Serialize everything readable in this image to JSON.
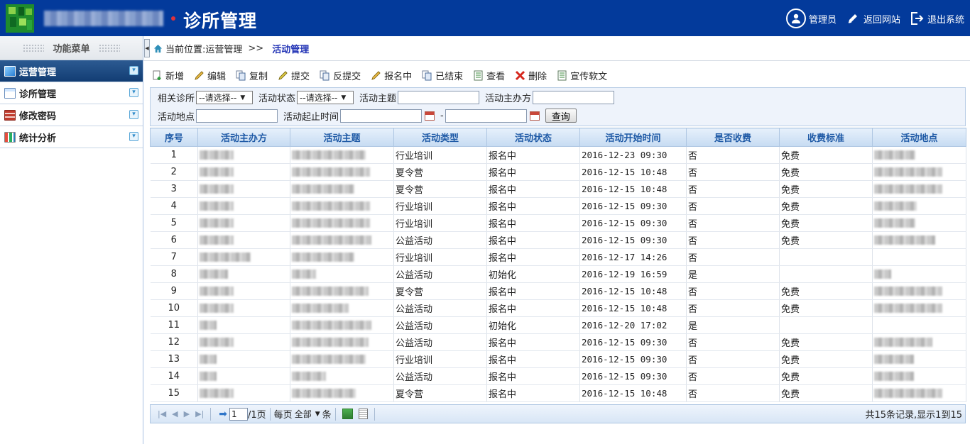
{
  "header": {
    "app_title": "诊所管理",
    "links": [
      {
        "label": "管理员",
        "icon": "user-avatar-icon"
      },
      {
        "label": "返回网站",
        "icon": "pencil-icon"
      },
      {
        "label": "退出系统",
        "icon": "logout-icon"
      }
    ]
  },
  "sidebar": {
    "title": "功能菜单",
    "items": [
      {
        "label": "运营管理",
        "active": true,
        "icon": "operations-icon"
      },
      {
        "label": "诊所管理",
        "active": false,
        "icon": "clinic-window-icon"
      },
      {
        "label": "修改密码",
        "active": false,
        "icon": "password-grid-icon"
      },
      {
        "label": "统计分析",
        "active": false,
        "icon": "bar-chart-icon"
      }
    ]
  },
  "breadcrumb": {
    "prefix": "当前位置:运营管理",
    "sep": ">>",
    "current": "活动管理"
  },
  "toolbar": [
    {
      "label": "新增",
      "icon": "add-doc-icon"
    },
    {
      "label": "编辑",
      "icon": "edit-pencil-icon"
    },
    {
      "label": "复制",
      "icon": "copy-icon"
    },
    {
      "label": "提交",
      "icon": "submit-pencil-icon"
    },
    {
      "label": "反提交",
      "icon": "unsubmit-icon"
    },
    {
      "label": "报名中",
      "icon": "signup-pencil-icon"
    },
    {
      "label": "已结束",
      "icon": "finished-icon"
    },
    {
      "label": "查看",
      "icon": "view-list-icon"
    },
    {
      "label": "删除",
      "icon": "delete-x-icon"
    },
    {
      "label": "宣传软文",
      "icon": "article-icon"
    }
  ],
  "filter": {
    "clinic_label": "相关诊所",
    "clinic_value": "--请选择--",
    "status_label": "活动状态",
    "status_value": "--请选择--",
    "topic_label": "活动主题",
    "topic_value": "",
    "organizer_label": "活动主办方",
    "organizer_value": "",
    "location_label": "活动地点",
    "location_value": "",
    "period_label": "活动起止时间",
    "period_start": "",
    "period_dash": "-",
    "period_end": "",
    "query_label": "查询"
  },
  "table": {
    "columns": [
      "序号",
      "活动主办方",
      "活动主题",
      "活动类型",
      "活动状态",
      "活动开始时间",
      "是否收费",
      "收费标准",
      "活动地点"
    ],
    "rows": [
      {
        "no": "1",
        "type": "行业培训",
        "status": "报名中",
        "start": "2016-12-23 09:30",
        "paid": "否",
        "fee": "免费"
      },
      {
        "no": "2",
        "type": "夏令营",
        "status": "报名中",
        "start": "2016-12-15 10:48",
        "paid": "否",
        "fee": "免费"
      },
      {
        "no": "3",
        "type": "夏令营",
        "status": "报名中",
        "start": "2016-12-15 10:48",
        "paid": "否",
        "fee": "免费"
      },
      {
        "no": "4",
        "type": "行业培训",
        "status": "报名中",
        "start": "2016-12-15 09:30",
        "paid": "否",
        "fee": "免费"
      },
      {
        "no": "5",
        "type": "行业培训",
        "status": "报名中",
        "start": "2016-12-15 09:30",
        "paid": "否",
        "fee": "免费"
      },
      {
        "no": "6",
        "type": "公益活动",
        "status": "报名中",
        "start": "2016-12-15 09:30",
        "paid": "否",
        "fee": "免费"
      },
      {
        "no": "7",
        "type": "行业培训",
        "status": "报名中",
        "start": "2016-12-17 14:26",
        "paid": "否",
        "fee": ""
      },
      {
        "no": "8",
        "type": "公益活动",
        "status": "初始化",
        "start": "2016-12-19 16:59",
        "paid": "是",
        "fee": ""
      },
      {
        "no": "9",
        "type": "夏令营",
        "status": "报名中",
        "start": "2016-12-15 10:48",
        "paid": "否",
        "fee": "免费"
      },
      {
        "no": "10",
        "type": "公益活动",
        "status": "报名中",
        "start": "2016-12-15 10:48",
        "paid": "否",
        "fee": "免费"
      },
      {
        "no": "11",
        "type": "公益活动",
        "status": "初始化",
        "start": "2016-12-20 17:02",
        "paid": "是",
        "fee": ""
      },
      {
        "no": "12",
        "type": "公益活动",
        "status": "报名中",
        "start": "2016-12-15 09:30",
        "paid": "否",
        "fee": "免费"
      },
      {
        "no": "13",
        "type": "行业培训",
        "status": "报名中",
        "start": "2016-12-15 09:30",
        "paid": "否",
        "fee": "免费"
      },
      {
        "no": "14",
        "type": "公益活动",
        "status": "报名中",
        "start": "2016-12-15 09:30",
        "paid": "否",
        "fee": "免费"
      },
      {
        "no": "15",
        "type": "夏令营",
        "status": "报名中",
        "start": "2016-12-15 10:48",
        "paid": "否",
        "fee": "免费"
      }
    ]
  },
  "pager": {
    "page_value": "1",
    "total_pages": "/1页",
    "per_page_label": "每页",
    "per_page_value": "全部",
    "unit": "条",
    "summary": "共15条记录,显示1到15"
  },
  "colors": {
    "header_bg": "#033a9b",
    "active_menu": "#1b4a85",
    "grid_header_text": "#1f5aa6",
    "breadcrumb_current": "#1d2fb4"
  }
}
